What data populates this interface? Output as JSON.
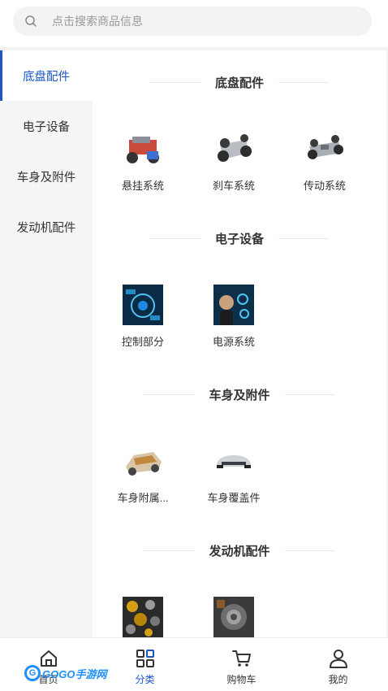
{
  "search": {
    "placeholder": "点击搜索商品信息",
    "icon": "search-icon"
  },
  "sidebar": {
    "items": [
      {
        "label": "底盘配件",
        "active": true
      },
      {
        "label": "电子设备",
        "active": false
      },
      {
        "label": "车身及附件",
        "active": false
      },
      {
        "label": "发动机配件",
        "active": false
      }
    ]
  },
  "sections": [
    {
      "title": "底盘配件",
      "items": [
        {
          "label": "悬挂系统"
        },
        {
          "label": "刹车系统"
        },
        {
          "label": "传动系统"
        }
      ]
    },
    {
      "title": "电子设备",
      "items": [
        {
          "label": "控制部分"
        },
        {
          "label": "电源系统"
        }
      ]
    },
    {
      "title": "车身及附件",
      "items": [
        {
          "label": "车身附属..."
        },
        {
          "label": "车身覆盖件"
        }
      ]
    },
    {
      "title": "发动机配件",
      "items": [
        {
          "label": ""
        },
        {
          "label": ""
        }
      ]
    }
  ],
  "tabbar": {
    "items": [
      {
        "label": "首页",
        "icon": "home-icon",
        "active": false
      },
      {
        "label": "分类",
        "icon": "category-icon",
        "active": true
      },
      {
        "label": "购物车",
        "icon": "cart-icon",
        "active": false
      },
      {
        "label": "我的",
        "icon": "user-icon",
        "active": false
      }
    ]
  },
  "watermark": {
    "text": "GOGO手游网"
  },
  "colors": {
    "accent": "#1a56c8",
    "sidebar_bg": "#f5f5f5",
    "page_bg": "#ffffff"
  }
}
